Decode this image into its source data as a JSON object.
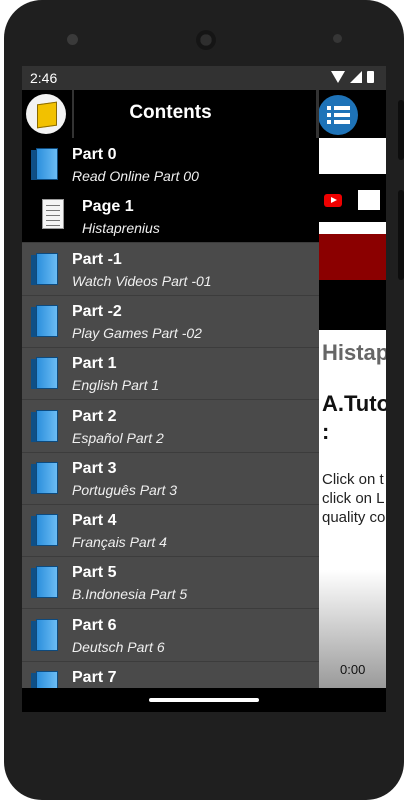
{
  "status": {
    "time": "2:46"
  },
  "drawer": {
    "title": "Contents",
    "items": [
      {
        "title": "Part 0",
        "subtitle": "Read Online Part 00",
        "icon": "book-icon",
        "style": "black"
      },
      {
        "title": "Page 1",
        "subtitle": "Histaprenius",
        "icon": "page-icon",
        "style": "black"
      },
      {
        "title": "Part -1",
        "subtitle": "Watch Videos Part -01",
        "icon": "book-icon"
      },
      {
        "title": "Part -2",
        "subtitle": "Play Games Part -02",
        "icon": "book-icon"
      },
      {
        "title": "Part 1",
        "subtitle": "English Part 1",
        "icon": "book-icon"
      },
      {
        "title": "Part 2",
        "subtitle": "Español Part 2",
        "icon": "book-icon"
      },
      {
        "title": "Part 3",
        "subtitle": "Português Part 3",
        "icon": "book-icon"
      },
      {
        "title": "Part 4",
        "subtitle": "Français Part 4",
        "icon": "book-icon"
      },
      {
        "title": "Part 5",
        "subtitle": "B.Indonesia Part 5",
        "icon": "book-icon"
      },
      {
        "title": "Part 6",
        "subtitle": "Deutsch Part 6",
        "icon": "book-icon"
      },
      {
        "title": "Part 7",
        "subtitle": "",
        "icon": "book-icon"
      }
    ]
  },
  "content": {
    "heading": "Histap",
    "subheading_line1": "A.Tuto",
    "subheading_line2": ":",
    "para_line1": "Click on t",
    "para_line2": "click on L",
    "para_line3": "quality co",
    "video_time": "0:00"
  },
  "colors": {
    "menu_button": "#1e73b8",
    "red_banner": "#8b0000",
    "drawer_bg": "#4a4a4a"
  }
}
